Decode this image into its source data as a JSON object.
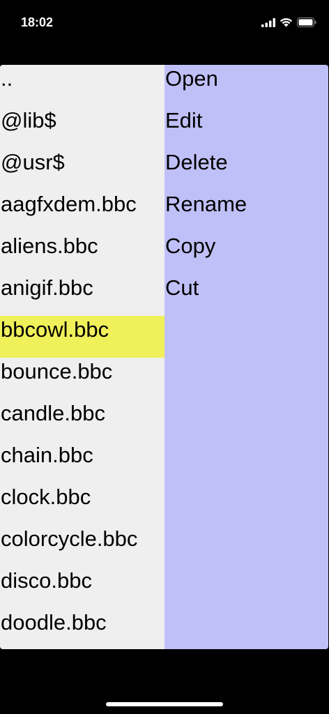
{
  "status_bar": {
    "time": "18:02",
    "icons": [
      "signal-icon",
      "wifi-icon",
      "battery-icon"
    ]
  },
  "file_list": {
    "items": [
      "..",
      "@lib$",
      "@usr$",
      "aagfxdem.bbc",
      "aliens.bbc",
      "anigif.bbc",
      "bbcowl.bbc",
      "bounce.bbc",
      "candle.bbc",
      "chain.bbc",
      "clock.bbc",
      "colorcycle.bbc",
      "disco.bbc",
      "doodle.bbc"
    ],
    "selected_index": 6
  },
  "context_menu": {
    "items": [
      "Open",
      "Edit",
      "Delete",
      "Rename",
      "Copy",
      "Cut"
    ]
  },
  "colors": {
    "list_background": "#efefef",
    "selected_highlight": "#f0f05a",
    "menu_background": "#c0c0f8"
  }
}
